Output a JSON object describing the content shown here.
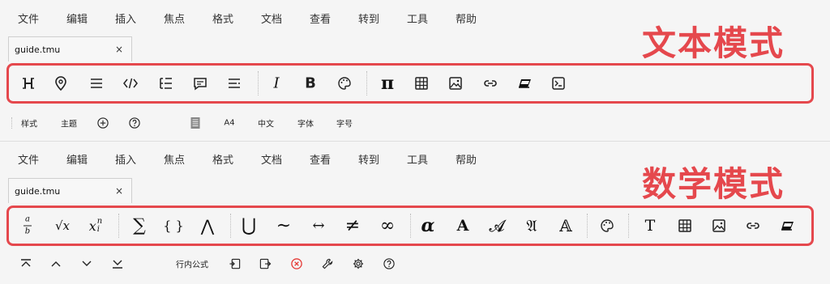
{
  "menu": [
    "文件",
    "编辑",
    "插入",
    "焦点",
    "格式",
    "文档",
    "查看",
    "转到",
    "工具",
    "帮助"
  ],
  "tab": {
    "name": "guide.tmu",
    "close": "×"
  },
  "labels": {
    "text_mode": "文本模式",
    "math_mode": "数学模式"
  },
  "text_toolbar": {
    "italic": "I",
    "bold": "B",
    "pi": "π"
  },
  "text_status": {
    "style": "样式",
    "theme": "主题",
    "paper": "A4",
    "lang": "中文",
    "font": "字体",
    "size": "字号"
  },
  "math_toolbar": {
    "frac_top": "a",
    "frac_bot": "b",
    "sqrt": "√x",
    "sub_base": "x",
    "sub_sup": "n",
    "sub_sub": "i",
    "sum": "∑",
    "braces": "{ }",
    "wedge": "⋀",
    "cup": "⋃",
    "sim": "∼",
    "leftright": "↔",
    "neq": "≠",
    "infty": "∞",
    "alpha": "α",
    "boldA": "A",
    "italA": "𝓐",
    "frakA": "𝔄",
    "bbA": "𝔸",
    "textT": "T"
  },
  "math_status": {
    "inline": "行内公式"
  }
}
